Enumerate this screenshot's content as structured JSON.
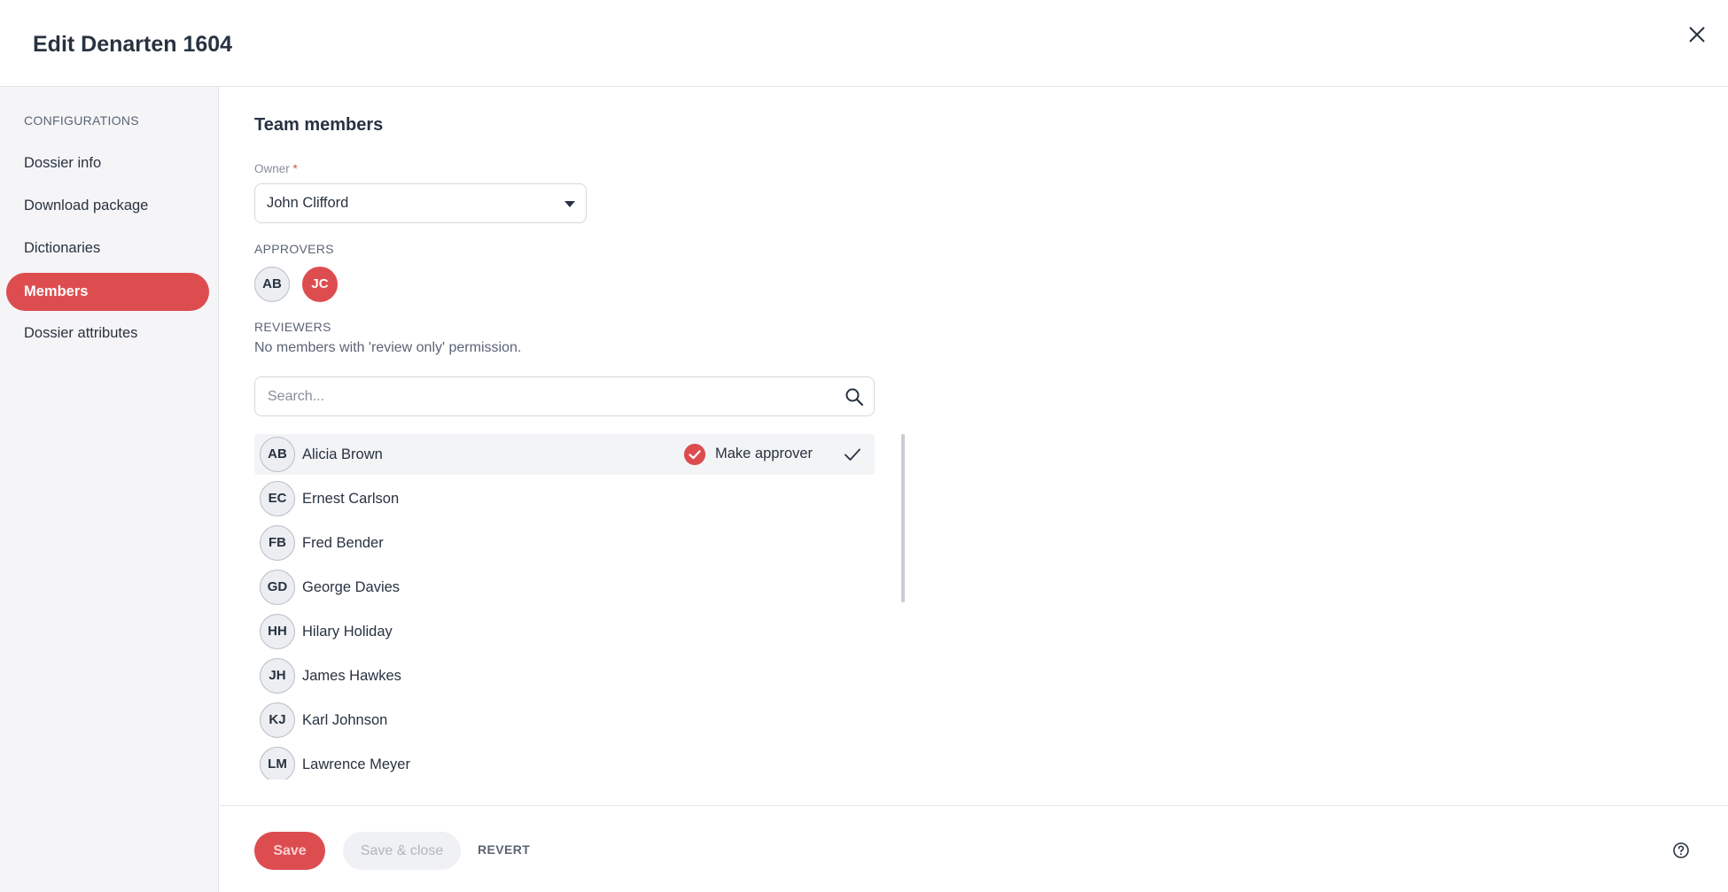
{
  "header": {
    "title": "Edit Denarten 1604"
  },
  "sidebar": {
    "section_label": "CONFIGURATIONS",
    "items": [
      {
        "label": "Dossier info"
      },
      {
        "label": "Download package"
      },
      {
        "label": "Dictionaries"
      },
      {
        "label": "Members",
        "active": true
      },
      {
        "label": "Dossier attributes"
      }
    ]
  },
  "main": {
    "title": "Team members",
    "owner": {
      "label": "Owner",
      "required_mark": "*",
      "value": "John Clifford"
    },
    "approvers": {
      "label": "APPROVERS",
      "avatars": [
        "AB",
        "JC"
      ]
    },
    "reviewers": {
      "label": "REVIEWERS",
      "empty_text": "No members with 'review only' permission."
    },
    "search": {
      "placeholder": "Search..."
    },
    "members": [
      {
        "initials": "AB",
        "name": "Alicia Brown",
        "action": "Make approver",
        "selected": true
      },
      {
        "initials": "EC",
        "name": "Ernest Carlson"
      },
      {
        "initials": "FB",
        "name": "Fred Bender"
      },
      {
        "initials": "GD",
        "name": "George Davies"
      },
      {
        "initials": "HH",
        "name": "Hilary Holiday"
      },
      {
        "initials": "JH",
        "name": "James Hawkes"
      },
      {
        "initials": "KJ",
        "name": "Karl Johnson"
      },
      {
        "initials": "LM",
        "name": "Lawrence Meyer"
      }
    ]
  },
  "footer": {
    "save_label": "Save",
    "save_close_label": "Save & close",
    "revert_label": "REVERT"
  },
  "colors": {
    "accent": "#dd4d50",
    "text": "#283241",
    "muted": "#5b6475",
    "sidebar_bg": "#f5f5f7"
  }
}
